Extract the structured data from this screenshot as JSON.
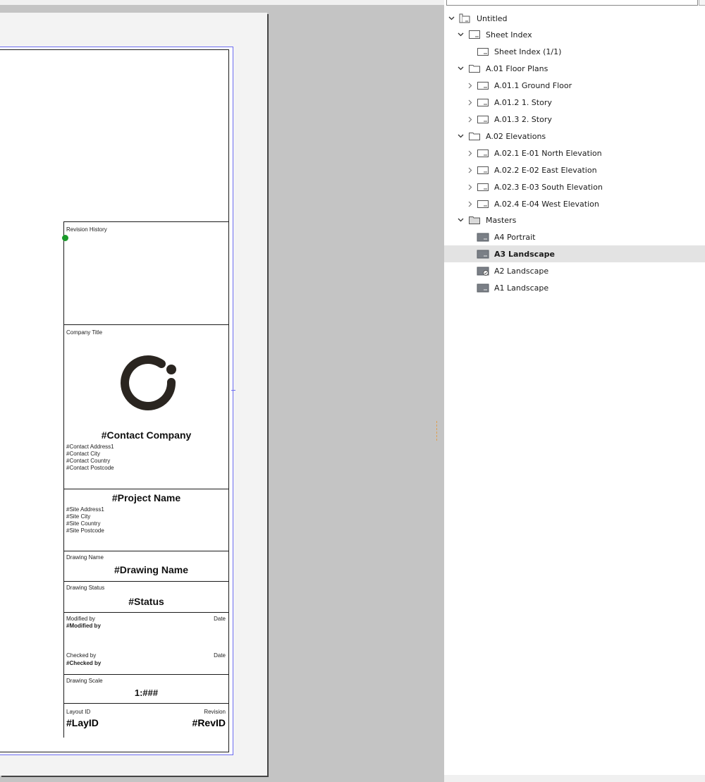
{
  "title_block": {
    "revision_history_label": "Revision History",
    "company_title_label": "Company Title",
    "contact_company": "#Contact Company",
    "contact_lines": [
      "#Contact Address1",
      "#Contact City",
      "#Contact Country",
      "#Contact Postcode"
    ],
    "project_name": "#Project Name",
    "site_lines": [
      "#Site Address1",
      "#Site City",
      "#Site Country",
      "#Site Postcode"
    ],
    "drawing_name_label": "Drawing Name",
    "drawing_name": "#Drawing Name",
    "drawing_status_label": "Drawing Status",
    "status": "#Status",
    "modified_by_label": "Modified by",
    "modified_by": "#Modified by",
    "date_label_1": "Date",
    "checked_by_label": "Checked by",
    "checked_by": "#Checked by",
    "date_label_2": "Date",
    "drawing_scale_label": "Drawing Scale",
    "scale": "1:###",
    "layout_id_label": "Layout ID",
    "layout_id": "#LayID",
    "revision_label": "Revision",
    "revision_id": "#RevID"
  },
  "navigator": {
    "items": [
      {
        "label": "Untitled",
        "icon": "book-icon",
        "chevron": "expanded"
      },
      {
        "label": "Sheet Index",
        "icon": "sheet-icon",
        "chevron": "expanded"
      },
      {
        "label": "Sheet Index (1/1)",
        "icon": "layout-icon",
        "chevron": "none"
      },
      {
        "label": "A.01 Floor Plans",
        "icon": "folder-icon",
        "chevron": "expanded"
      },
      {
        "label": "A.01.1 Ground Floor",
        "icon": "layout-icon",
        "chevron": "collapsed"
      },
      {
        "label": "A.01.2 1. Story",
        "icon": "layout-icon",
        "chevron": "collapsed"
      },
      {
        "label": "A.01.3 2. Story",
        "icon": "layout-icon",
        "chevron": "collapsed"
      },
      {
        "label": "A.02 Elevations",
        "icon": "folder-icon",
        "chevron": "expanded"
      },
      {
        "label": "A.02.1 E-01 North Elevation",
        "icon": "layout-icon",
        "chevron": "collapsed"
      },
      {
        "label": "A.02.2 E-02 East Elevation",
        "icon": "layout-icon",
        "chevron": "collapsed"
      },
      {
        "label": "A.02.3 E-03 South Elevation",
        "icon": "layout-icon",
        "chevron": "collapsed"
      },
      {
        "label": "A.02.4 E-04 West Elevation",
        "icon": "layout-icon",
        "chevron": "collapsed"
      },
      {
        "label": "Masters",
        "icon": "folder-dark-icon",
        "chevron": "expanded"
      },
      {
        "label": "A4 Portrait",
        "icon": "master-icon",
        "chevron": "none"
      },
      {
        "label": "A3 Landscape",
        "icon": "master-icon",
        "chevron": "none",
        "selected": true
      },
      {
        "label": "A2 Landscape",
        "icon": "master-check-icon",
        "chevron": "none"
      },
      {
        "label": "A1 Landscape",
        "icon": "master-icon",
        "chevron": "none"
      }
    ]
  }
}
